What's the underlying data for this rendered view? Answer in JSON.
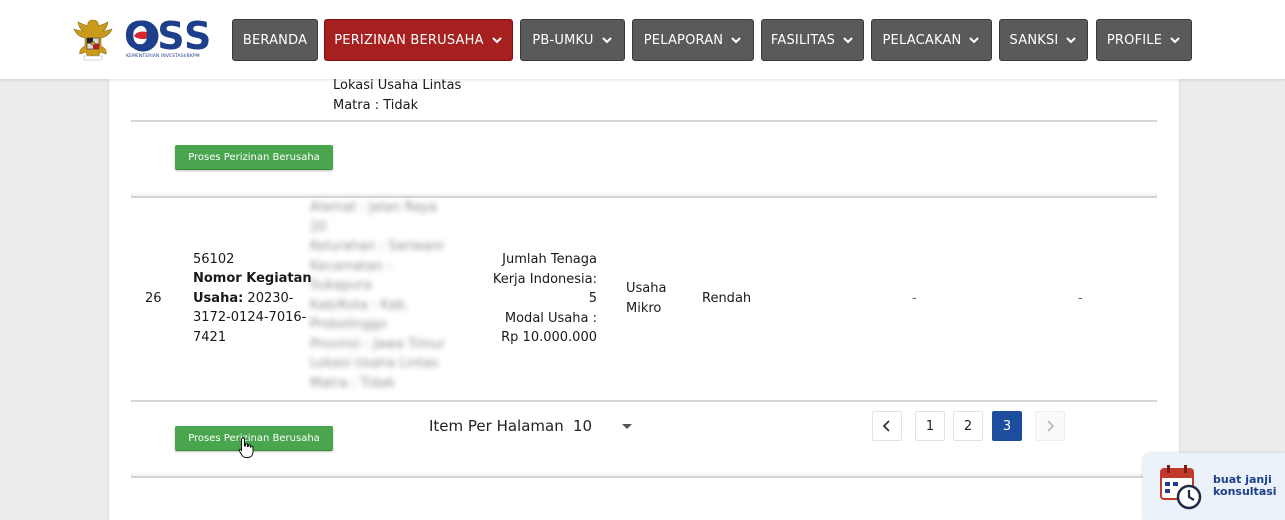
{
  "header": {
    "logo_text": "OSS",
    "logo_subtitle": "KEMENTERIAN INVESTASI/BKPM",
    "nav": [
      {
        "label": "BERANDA",
        "dropdown": false,
        "active": false
      },
      {
        "label": "PERIZINAN BERUSAHA",
        "dropdown": true,
        "active": true
      },
      {
        "label": "PB-UMKU",
        "dropdown": true,
        "active": false
      },
      {
        "label": "PELAPORAN",
        "dropdown": true,
        "active": false
      },
      {
        "label": "FASILITAS",
        "dropdown": true,
        "active": false
      },
      {
        "label": "PELACAKAN",
        "dropdown": true,
        "active": false
      },
      {
        "label": "SANKSI",
        "dropdown": true,
        "active": false
      },
      {
        "label": "PROFILE",
        "dropdown": true,
        "active": false
      }
    ]
  },
  "table": {
    "prev_row": {
      "location_tail_1": "Lokasi Usaha Lintas",
      "location_tail_2": "Matra : Tidak"
    },
    "action_label": "Proses Perizinan Berusaha",
    "row": {
      "no": "26",
      "kbli": "56102",
      "nomor_label_1": "Nomor Kegiatan",
      "nomor_label_2": "Usaha:",
      "nomor_value_1": " 20230-",
      "nomor_value_2": "3172-0124-7016-",
      "nomor_value_3": "7421",
      "address_lines": [
        "Alamat : Jalan Raya",
        "20",
        "Kelurahan : Sariwani",
        "Kecamatan :",
        "Sukapura",
        "Kab/Kota : Kab.",
        "Probolinggo",
        "Provinsi : Jawa Timur",
        "Lokasi Usaha Lintas",
        "Matra : Tidak"
      ],
      "tenaga_1": "Jumlah Tenaga",
      "tenaga_2": "Kerja Indonesia:",
      "tenaga_3": "5",
      "modal_1": "Modal Usaha :",
      "modal_2": "Rp 10.000.000",
      "skala_1": "Usaha",
      "skala_2": "Mikro",
      "risiko": "Rendah",
      "col8": "-",
      "col9": "-"
    }
  },
  "pagination": {
    "per_page_label": "Item Per Halaman",
    "per_page_value": "10",
    "prev": "‹",
    "pages": [
      "1",
      "2",
      "3"
    ],
    "current": "3",
    "next": "›"
  },
  "consult_widget": {
    "label": "buat janji\nkonsultasi"
  },
  "colors": {
    "nav_default": "#5a5a5a",
    "nav_active": "#a62020",
    "action_green": "#4aa54f",
    "page_active": "#1d4e9e",
    "brand_blue": "#1d3f8c"
  }
}
